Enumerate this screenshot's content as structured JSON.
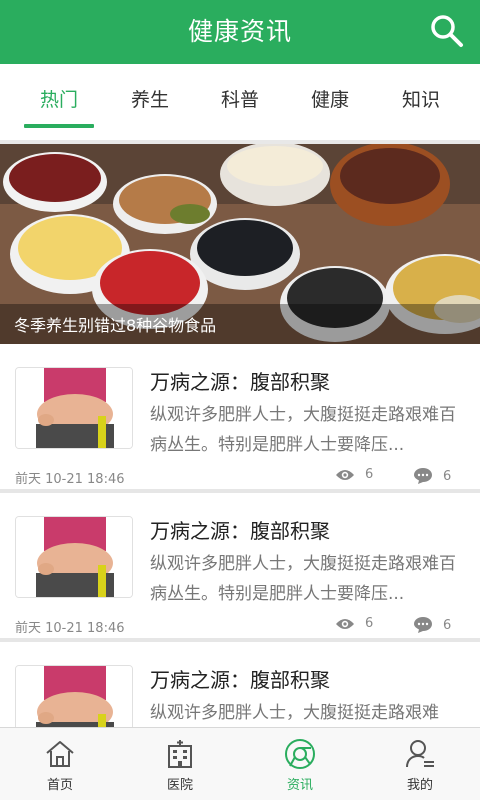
{
  "header": {
    "title": "健康资讯",
    "accent": "#2aad5e"
  },
  "tabs": [
    {
      "label": "热门",
      "active": true
    },
    {
      "label": "养生",
      "active": false
    },
    {
      "label": "科普",
      "active": false
    },
    {
      "label": "健康",
      "active": false
    },
    {
      "label": "知识",
      "active": false
    }
  ],
  "banner": {
    "caption": "冬季养生别错过8种谷物食品"
  },
  "articles": [
    {
      "title": "万病之源：腹部积聚",
      "summary": "纵观许多肥胖人士，大腹挺挺走路艰难百病丛生。特别是肥胖人士要降压...",
      "time": "前天 10-21 18:46",
      "views": "6",
      "comments": "6"
    },
    {
      "title": "万病之源：腹部积聚",
      "summary": "纵观许多肥胖人士，大腹挺挺走路艰难百病丛生。特别是肥胖人士要降压...",
      "time": "前天 10-21 18:46",
      "views": "6",
      "comments": "6"
    },
    {
      "title": "万病之源：腹部积聚",
      "summary": "纵观许多肥胖人士，大腹挺挺走路艰难",
      "time": "",
      "views": "",
      "comments": ""
    }
  ],
  "bottom_nav": [
    {
      "label": "首页",
      "icon": "home-icon",
      "active": false
    },
    {
      "label": "医院",
      "icon": "hospital-icon",
      "active": false
    },
    {
      "label": "资讯",
      "icon": "news-icon",
      "active": true
    },
    {
      "label": "我的",
      "icon": "profile-icon",
      "active": false
    }
  ]
}
